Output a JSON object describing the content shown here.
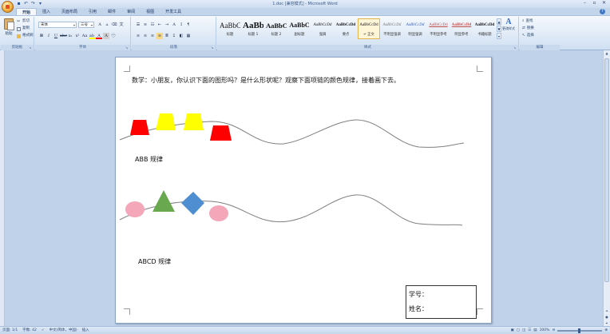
{
  "window": {
    "title": "1.doc [兼容模式] - Microsoft Word",
    "qat": [
      "save-icon",
      "undo-icon",
      "redo-icon",
      "dropdown-icon"
    ],
    "controls": [
      "–",
      "▫",
      "✕"
    ]
  },
  "tabs": [
    "开始",
    "插入",
    "页面布局",
    "引用",
    "邮件",
    "审阅",
    "视图",
    "开发工具"
  ],
  "ribbon": {
    "clipboard": {
      "paste": "粘贴",
      "cut": "剪切",
      "copy": "复制",
      "format_painter": "格式刷",
      "label": "剪贴板"
    },
    "font": {
      "name": "宋体",
      "size": "三号",
      "label": "字体"
    },
    "paragraph": {
      "label": "段落"
    },
    "styles": {
      "label": "样式",
      "items": [
        {
          "sample": "AaBbC",
          "name": "标题"
        },
        {
          "sample": "AaBb",
          "name": "标题 1"
        },
        {
          "sample": "AaBbC",
          "name": "标题 2"
        },
        {
          "sample": "AaBbC",
          "name": "副标题"
        },
        {
          "sample": "AaBbCcDd",
          "name": "强调"
        },
        {
          "sample": "AaBbCcDd",
          "name": "要点"
        },
        {
          "sample": "AaBbCcDd",
          "name": "↵ 正文"
        },
        {
          "sample": "AaBbCcDd",
          "name": "不明显强调"
        },
        {
          "sample": "AaBbCcDd",
          "name": "明显强调"
        },
        {
          "sample": "AaBbCcDd",
          "name": "不明显参考"
        },
        {
          "sample": "AaBbCcDd",
          "name": "明显参考"
        },
        {
          "sample": "AaBbCcDd",
          "name": "书籍标题"
        }
      ],
      "selected_index": 6,
      "change_styles": "更改样式"
    },
    "editing": {
      "find": "查找",
      "replace": "替换",
      "select": "选择",
      "label": "编辑"
    }
  },
  "document": {
    "question": "数学：小朋友，你认识下面的图形吗？是什么形状呢？观察下面项链的颜色规律，接着画下去。",
    "pattern1_label": "ABB 规律",
    "pattern2_label": "ABCD 规律",
    "name_box": {
      "student_no": "学号：",
      "name": "姓名："
    },
    "colors": {
      "red": "#ff0000",
      "yellow": "#ffff00",
      "pink": "#f4a7b9",
      "green": "#6aa84f",
      "blue": "#4f8fd1",
      "string": "#7f7f7f"
    }
  },
  "statusbar": {
    "page": "页面: 1/1",
    "words": "字数: 42",
    "language": "中文(简体，中国)",
    "mode": "插入",
    "zoom": "100%"
  }
}
